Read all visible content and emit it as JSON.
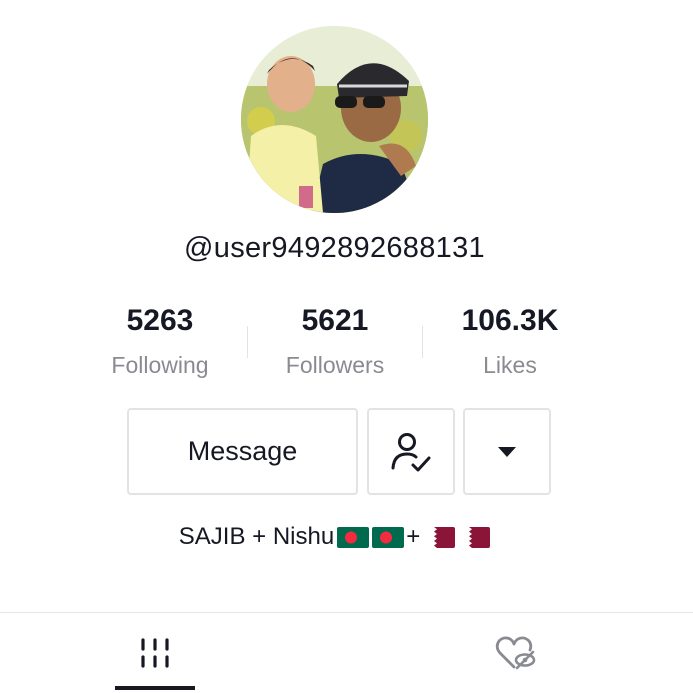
{
  "profile": {
    "username": "@user9492892688131",
    "bio_text": "SAJIB + Nishu",
    "bio_separator": "+",
    "bio_flags": [
      "bangladesh-flag",
      "bangladesh-flag",
      "qatar-flag",
      "qatar-flag"
    ]
  },
  "stats": {
    "following_count": "5263",
    "following_label": "Following",
    "followers_count": "5621",
    "followers_label": "Followers",
    "likes_count": "106.3K",
    "likes_label": "Likes"
  },
  "actions": {
    "message_label": "Message",
    "follow_icon": "user-check-icon",
    "more_icon": "caret-down-icon"
  },
  "tabs": [
    {
      "name": "videos",
      "icon": "grid-columns-icon",
      "active": true
    },
    {
      "name": "liked",
      "icon": "heart-hidden-icon",
      "active": false
    }
  ],
  "colors": {
    "text": "#161823",
    "secondary_text": "#8a8b91",
    "border": "#e3e3e4",
    "bangladesh_green": "#006a4e",
    "bangladesh_red": "#f42a41",
    "qatar_maroon": "#8a1538"
  }
}
